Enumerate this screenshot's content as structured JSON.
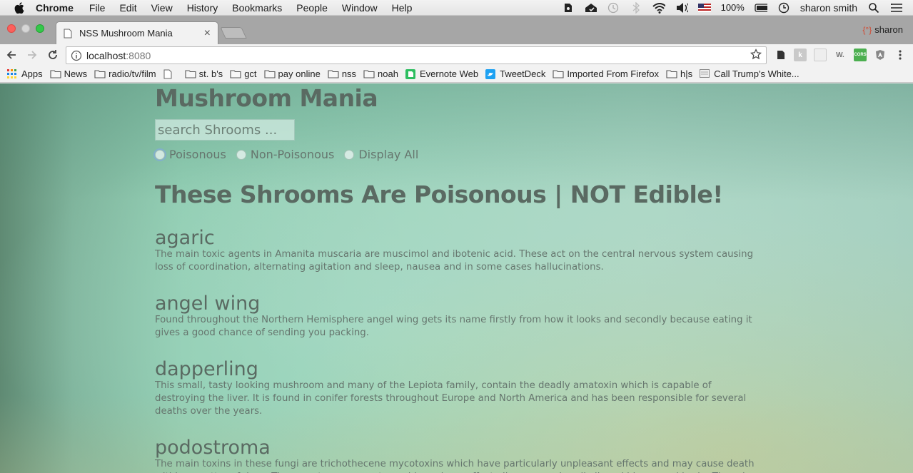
{
  "menubar": {
    "app": "Chrome",
    "items": [
      "File",
      "Edit",
      "View",
      "History",
      "Bookmarks",
      "People",
      "Window",
      "Help"
    ],
    "battery": "100%",
    "user": "sharon smith"
  },
  "tab": {
    "title": "NSS Mushroom Mania",
    "profile": "sharon"
  },
  "omnibox": {
    "host": "localhost",
    "port": ":8080"
  },
  "bookmarks": [
    {
      "label": "Apps",
      "icon": "apps-grid-icon"
    },
    {
      "label": "News",
      "icon": "folder-icon"
    },
    {
      "label": "radio/tv/film",
      "icon": "folder-icon"
    },
    {
      "label": "",
      "icon": "page-icon"
    },
    {
      "label": "st. b's",
      "icon": "folder-icon"
    },
    {
      "label": "gct",
      "icon": "folder-icon"
    },
    {
      "label": "pay online",
      "icon": "folder-icon"
    },
    {
      "label": "nss",
      "icon": "folder-icon"
    },
    {
      "label": "noah",
      "icon": "folder-icon"
    },
    {
      "label": "Evernote Web",
      "icon": "evernote-icon"
    },
    {
      "label": "TweetDeck",
      "icon": "tweetdeck-icon"
    },
    {
      "label": "Imported From Firefox",
      "icon": "folder-icon"
    },
    {
      "label": "h|s",
      "icon": "folder-icon"
    },
    {
      "label": "Call Trump's White...",
      "icon": "page-icon"
    }
  ],
  "page": {
    "title": "Mushroom Mania",
    "search_placeholder": "search Shrooms ...",
    "filters": [
      "Poisonous",
      "Non-Poisonous",
      "Display All"
    ],
    "heading": "These Shrooms Are Poisonous | NOT Edible!",
    "shrooms": [
      {
        "name": "agaric",
        "desc": "The main toxic agents in Amanita muscaria are muscimol and ibotenic acid. These act on the central nervous system causing loss of coordination, alternating agitation and sleep, nausea and in some cases hallucinations."
      },
      {
        "name": "angel wing",
        "desc": "Found throughout the Northern Hemisphere angel wing gets its name firstly from how it looks and secondly because eating it gives a good chance of sending you packing."
      },
      {
        "name": "dapperling",
        "desc": "This small, tasty looking mushroom and many of the Lepiota family, contain the deadly amatoxin which is capable of destroying the liver. It is found in conifer forests throughout Europe and North America and has been responsible for several deaths over the years."
      },
      {
        "name": "podostroma",
        "desc": "The main toxins in these fungi are trichothecene mycotoxins which have particularly unpleasant effects and may cause death within a matter of days. The symptoms are system wide and can affect all organs, primarily liver, kidneys and brain. There is also a depletion of"
      }
    ]
  },
  "colors": {
    "bg_teal": "#9cd6bd",
    "text": "#5c6a62",
    "close_red": "#fc605c",
    "max_green": "#34c84a"
  }
}
